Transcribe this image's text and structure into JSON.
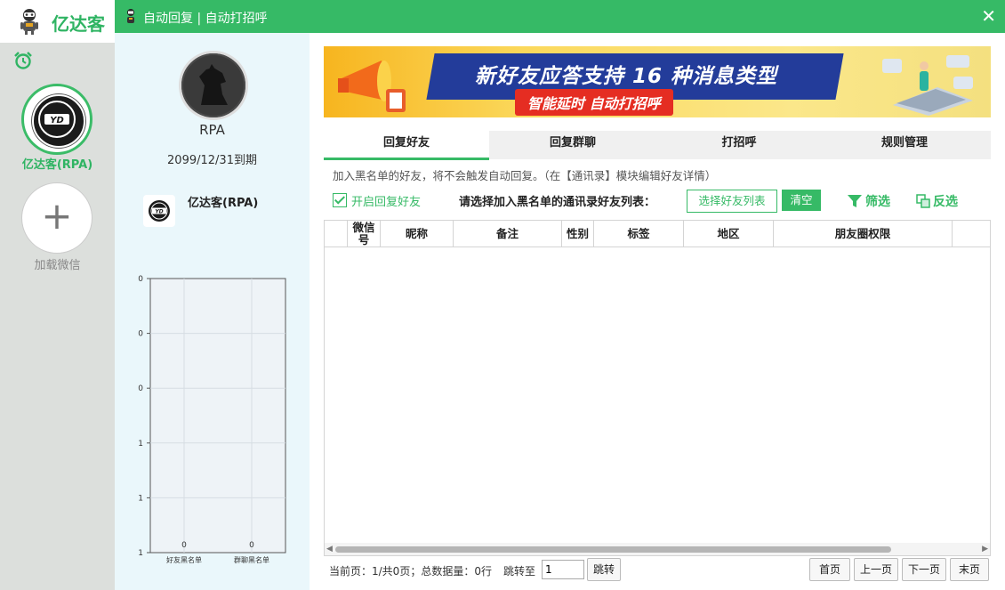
{
  "app": {
    "name": "亿达客"
  },
  "rail": {
    "account_label": "亿达客(RPA)",
    "add_label": "加载微信"
  },
  "window": {
    "title": "自动回复 | 自动打招呼"
  },
  "profile": {
    "username": "RPA",
    "expire": "2099/12/31到期",
    "product_name": "亿达客(RPA)"
  },
  "chart_data": {
    "type": "bar",
    "categories": [
      "好友黑名单",
      "群聊黑名单"
    ],
    "values": [
      0,
      0
    ],
    "y_tick_labels": [
      "1",
      "1",
      "1",
      "0",
      "0",
      "0"
    ],
    "ylim": [
      0,
      1
    ],
    "grid": true,
    "data_labels": [
      "0",
      "0"
    ]
  },
  "banner": {
    "headline": "新好友应答支持 16 种消息类型",
    "tagline": "智能延时 自动打招呼"
  },
  "tabs": [
    {
      "label": "回复好友",
      "active": true
    },
    {
      "label": "回复群聊",
      "active": false
    },
    {
      "label": "打招呼",
      "active": false
    },
    {
      "label": "规则管理",
      "active": false
    }
  ],
  "hint": "加入黑名单的好友，将不会触发自动回复。（在【通讯录】模块编辑好友详情）",
  "toolbar": {
    "enable_label": "开启回复好友",
    "enable_checked": true,
    "prompt": "请选择加入黑名单的通讯录好友列表：",
    "select_button": "选择好友列表",
    "clear_button": "清空",
    "filter_label": "筛选",
    "invert_label": "反选"
  },
  "table": {
    "columns": [
      "",
      "微信号",
      "昵称",
      "备注",
      "性别",
      "标签",
      "地区",
      "朋友圈权限"
    ],
    "rows": []
  },
  "pager": {
    "info": "当前页：1/共0页；总数据量：0行",
    "jump_label": "跳转至",
    "jump_value": "1",
    "jump_button": "跳转",
    "first": "首页",
    "prev": "上一页",
    "next": "下一页",
    "last": "末页"
  },
  "colors": {
    "accent": "#36ba66",
    "banner_blue": "#233c9a",
    "banner_red": "#e52d22"
  }
}
